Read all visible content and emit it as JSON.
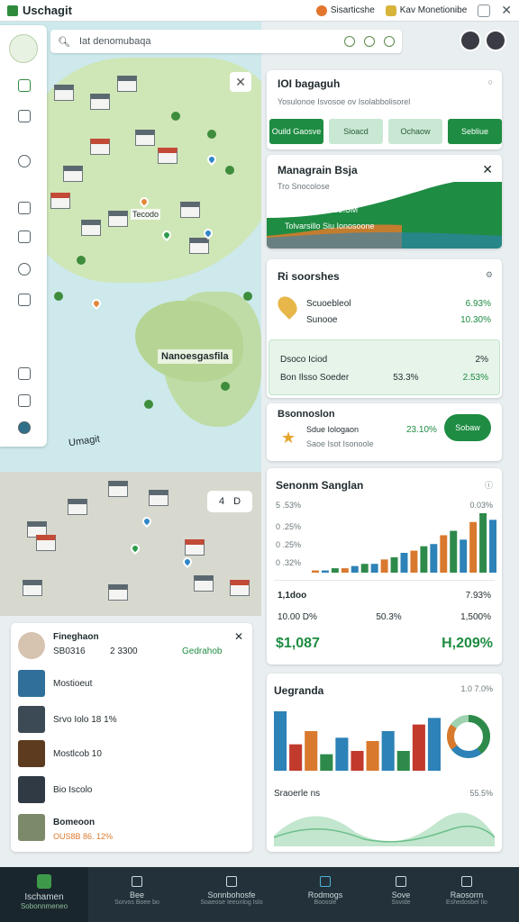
{
  "app": {
    "title": "Uschagit"
  },
  "topbar": {
    "status_a": "Sisarticshe",
    "status_b": "Kav Monetionibe"
  },
  "search": {
    "value": "Iat denomubaqa"
  },
  "map": {
    "island_label": "Nanoesgasfila",
    "region_label": "Umagit",
    "pin_label": "Tecodo",
    "chip": [
      "4",
      "D"
    ]
  },
  "card1": {
    "title": "IOI bagaguh",
    "subtitle": "Yosulonoe Isvosoe ov Isolabbolisorel",
    "buttons": [
      "Ouild Gaosve",
      "Sioacd",
      "Ochaow",
      "Sebliue"
    ]
  },
  "promo": {
    "title": "Managrain Bsja",
    "line1": "Tro Snocolose",
    "line2": "Susato Isor 15.5M",
    "line3": "Tolvarsillo Siu Ionosoone"
  },
  "card3": {
    "title": "Ri soorshes",
    "rows": [
      {
        "label": "Scuoebleol",
        "value": "6.93%"
      },
      {
        "label": "Sunooe",
        "value": "10.30%"
      }
    ],
    "box_rows": [
      {
        "label": "Dsoco Iciod",
        "value": "2%"
      },
      {
        "label": "Bon   Ilsso Soeder",
        "mid": "53.3%",
        "value": "2.53%"
      }
    ]
  },
  "card4": {
    "title": "Bsonnoslon",
    "line1": "Sdue Iologaon",
    "line2": "Saoe Isot Isonoole",
    "value": "23.10%",
    "pill": "Sobaw"
  },
  "card5": {
    "title": "Senonm Sanglan",
    "y_labels": [
      "5 .53%",
      "0 .25%",
      "0 .25%",
      "0 .32%",
      "0"
    ],
    "right_label": "0.03%",
    "stats": [
      {
        "label": "1,1doo",
        "value": "7.93%"
      },
      {
        "label": "10.00 D%",
        "mid": "50.3%",
        "value": "1,500%"
      }
    ],
    "big_left": "$1,087",
    "big_right": "H,209%"
  },
  "card6": {
    "title": "Uegranda",
    "meta": "1.0 7.0%",
    "line_title": "Sraoerle ns",
    "line_value": "55.5%"
  },
  "bl": {
    "name": "Fineghaon",
    "id": "SB0316",
    "id_val": "2 3300",
    "badge": "Gedrahob",
    "rows": [
      "Mostioeut",
      "Srvo Iolo 18   1%",
      "Mostlcob   10",
      "Bio Iscolo"
    ],
    "last_title": "Bomeoon",
    "last_sub": "OUS8B  86. 12%"
  },
  "bottomnav": {
    "brand": "Ischamen",
    "brand_sub": "Sobonnmeneo",
    "items": [
      "Bee",
      "Sonnbohosfe",
      "Rodmogs",
      "Sove",
      "Raosorm"
    ],
    "subs": [
      "Sorvos Boee bo",
      "Soaeose Ieeunlog Islo",
      "Boossle",
      "Ssvide",
      "Eshedosbel Iio"
    ]
  },
  "chart_data": [
    {
      "type": "bar",
      "title": "Senonm Sanglan",
      "values": [
        1,
        1,
        2,
        2,
        3,
        4,
        4,
        6,
        7,
        9,
        10,
        12,
        13,
        17,
        19,
        15,
        23,
        27,
        24
      ],
      "colors": [
        "#d9792e",
        "#2d82b7",
        "#2e8a4a",
        "#d9792e",
        "#2d82b7",
        "#2e8a4a",
        "#2d82b7",
        "#d9792e",
        "#2e8a4a",
        "#2d82b7",
        "#d9792e",
        "#2e8a4a",
        "#2d82b7",
        "#d9792e",
        "#2e8a4a",
        "#2d82b7",
        "#d9792e",
        "#2e8a4a",
        "#2d82b7"
      ]
    },
    {
      "type": "bar",
      "title": "Uegranda",
      "values": [
        18,
        8,
        12,
        5,
        10,
        6,
        9,
        12,
        6,
        14,
        16
      ],
      "colors": [
        "#2d82b7",
        "#c23a2c",
        "#d9792e",
        "#2e8a4a",
        "#2d82b7",
        "#c23a2c",
        "#d9792e",
        "#2d82b7",
        "#2e8a4a",
        "#c23a2c",
        "#2d82b7"
      ]
    },
    {
      "type": "pie",
      "values": [
        40,
        25,
        20,
        15
      ],
      "colors": [
        "#2e8a4a",
        "#2d82b7",
        "#d9792e",
        "#9fd3b0"
      ]
    }
  ]
}
